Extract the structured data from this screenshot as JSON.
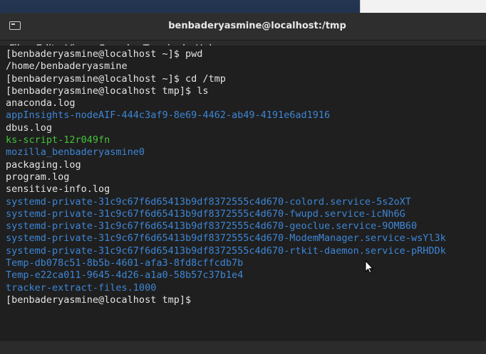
{
  "window": {
    "title": "benbaderyasmine@localhost:/tmp",
    "icon": "terminal-icon"
  },
  "menu": [
    "File",
    "Edit",
    "View",
    "Search",
    "Terminal",
    "Help"
  ],
  "colors": {
    "directory": "#3d86d6",
    "executable": "#45c23a",
    "text": "#e4e4e4",
    "background": "#1f1f1f"
  },
  "terminal": {
    "lines": [
      {
        "text": "[benbaderyasmine@localhost ~]$ pwd",
        "type": "prompt"
      },
      {
        "text": "/home/benbaderyasmine",
        "type": "output"
      },
      {
        "text": "[benbaderyasmine@localhost ~]$ cd /tmp",
        "type": "prompt"
      },
      {
        "text": "[benbaderyasmine@localhost tmp]$ ls",
        "type": "prompt"
      },
      {
        "text": "anaconda.log",
        "type": "file"
      },
      {
        "text": "appInsights-nodeAIF-444c3af9-8e69-4462-ab49-4191e6ad1916",
        "type": "dir"
      },
      {
        "text": "dbus.log",
        "type": "file"
      },
      {
        "text": "ks-script-12r049fn",
        "type": "exec"
      },
      {
        "text": "mozilla_benbaderyasmine0",
        "type": "dir"
      },
      {
        "text": "packaging.log",
        "type": "file"
      },
      {
        "text": "program.log",
        "type": "file"
      },
      {
        "text": "sensitive-info.log",
        "type": "file"
      },
      {
        "text": "systemd-private-31c9c67f6d65413b9df8372555c4d670-colord.service-5s2oXT",
        "type": "dir"
      },
      {
        "text": "systemd-private-31c9c67f6d65413b9df8372555c4d670-fwupd.service-icNh6G",
        "type": "dir"
      },
      {
        "text": "systemd-private-31c9c67f6d65413b9df8372555c4d670-geoclue.service-9OMB60",
        "type": "dir"
      },
      {
        "text": "systemd-private-31c9c67f6d65413b9df8372555c4d670-ModemManager.service-wsYl3k",
        "type": "dir"
      },
      {
        "text": "systemd-private-31c9c67f6d65413b9df8372555c4d670-rtkit-daemon.service-pRHDDk",
        "type": "dir"
      },
      {
        "text": "Temp-db078c51-8b5b-4601-afa3-8fd8cffcdb7b",
        "type": "dir"
      },
      {
        "text": "Temp-e22ca011-9645-4d26-a1a0-58b57c37b1e4",
        "type": "dir"
      },
      {
        "text": "tracker-extract-files.1000",
        "type": "dir"
      },
      {
        "text": "[benbaderyasmine@localhost tmp]$ ",
        "type": "prompt"
      }
    ]
  }
}
